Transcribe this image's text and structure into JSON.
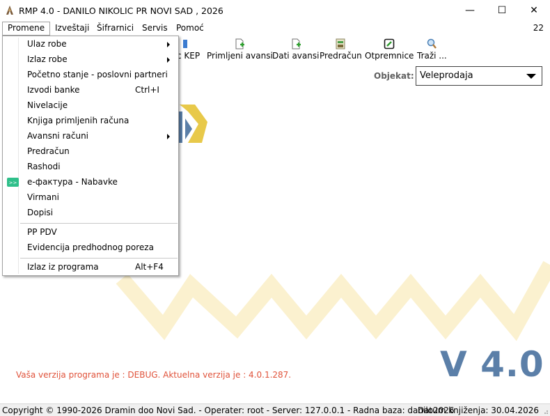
{
  "window": {
    "title": "RMP 4.0 - DANILO NIKOLIC PR NOVI SAD , 2026",
    "minimize": "—",
    "maximize": "☐",
    "close": "✕"
  },
  "menubar": {
    "items": [
      "Promene",
      "Izveštaji",
      "Šifrarnici",
      "Servis",
      "Pomoć"
    ],
    "number": "22"
  },
  "toolbar": {
    "items": [
      {
        "label": "c KEP",
        "icon": "kep-icon"
      },
      {
        "label": "Primljeni avansi",
        "icon": "document-add-icon"
      },
      {
        "label": "Dati avansi",
        "icon": "document-add-icon"
      },
      {
        "label": "Predračun",
        "icon": "invoice-icon"
      },
      {
        "label": "Otpremnice",
        "icon": "delivery-note-icon"
      },
      {
        "label": "Traži ...",
        "icon": "magnifier-icon"
      }
    ]
  },
  "objekat": {
    "label": "Objekat:",
    "value": "Veleprodaja"
  },
  "dropdown": {
    "items": [
      {
        "label": "Ulaz robe",
        "submenu": true
      },
      {
        "label": "Izlaz robe",
        "submenu": true
      },
      {
        "label": "Početno stanje - poslovni partneri"
      },
      {
        "label": "Izvodi banke",
        "shortcut": "Ctrl+I"
      },
      {
        "label": "Nivelacije"
      },
      {
        "label": "Knjiga primljenih računa"
      },
      {
        "label": "Avansni računi",
        "submenu": true
      },
      {
        "label": "Predračun"
      },
      {
        "label": "Rashodi"
      },
      {
        "label": "е-фактура - Nabavke",
        "icon": "efaktura-icon"
      },
      {
        "label": "Virmani"
      },
      {
        "label": "Dopisi"
      },
      {
        "label": "PP PDV"
      },
      {
        "label": "Evidencija predhodnog poreza"
      },
      {
        "label": "Izlaz iz programa",
        "shortcut": "Alt+F4"
      }
    ]
  },
  "main": {
    "version_big": "V 4.0",
    "version_message": "Vaša verzija programa je : DEBUG. Aktuelna verzija je : 4.0.1.287."
  },
  "statusbar": {
    "left": "Copyright © 1990-2026 Dramin doo Novi Sad. - Operater: root - Server: 127.0.0.1 - Radna baza: danilo2026",
    "right": "Datum knjiženja: 30.04.2026"
  },
  "colors": {
    "accent_blue": "#5b7fa8",
    "logo_yellow": "#e8c94a",
    "version_message_red": "#e0523a"
  }
}
